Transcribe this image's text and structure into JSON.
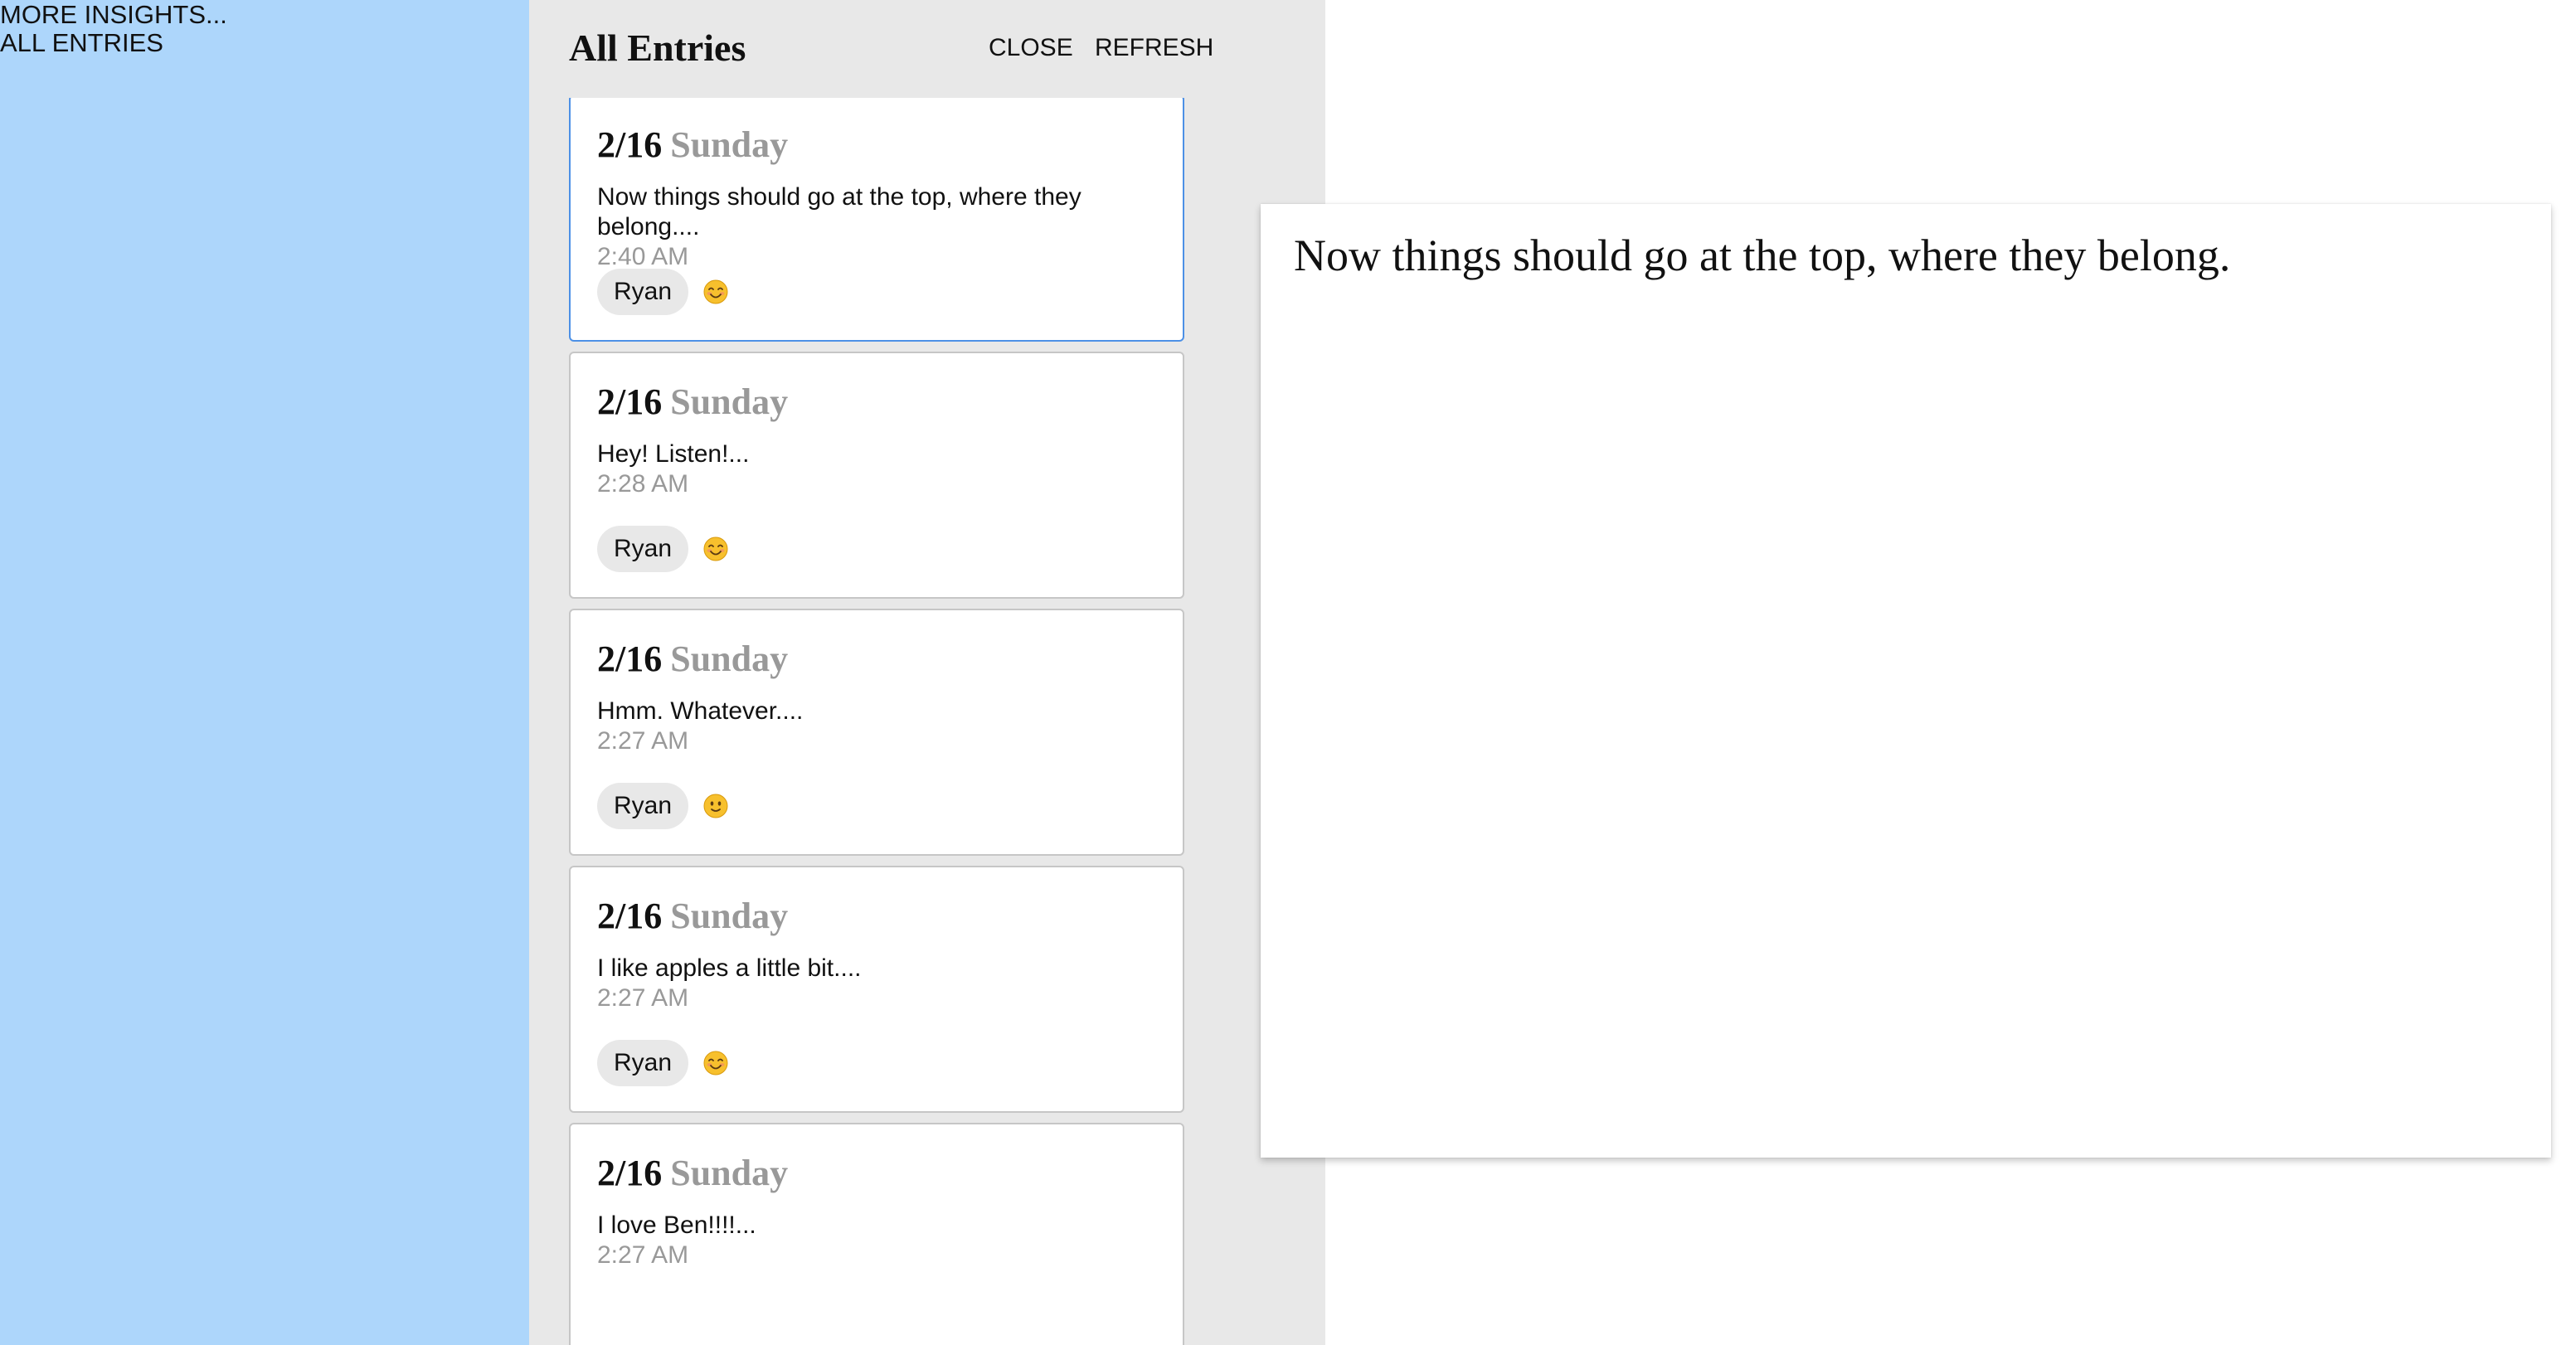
{
  "sidebar": {
    "links": [
      "MORE INSIGHTS...",
      "ALL ENTRIES"
    ]
  },
  "entries_panel": {
    "title": "All Entries",
    "close_label": "CLOSE",
    "refresh_label": "REFRESH",
    "entries": [
      {
        "date": "2/16",
        "day": "Sunday",
        "preview": "",
        "time": "",
        "author": "Ryan",
        "mood_icon": "smiling-face-icon",
        "selected": false
      },
      {
        "date": "2/16",
        "day": "Sunday",
        "preview": "Now things should go at the top, where they belong....",
        "time": "2:40 AM",
        "author": "Ryan",
        "mood_icon": "smiling-face-icon",
        "selected": true
      },
      {
        "date": "2/16",
        "day": "Sunday",
        "preview": "Hey! Listen!...",
        "time": "2:28 AM",
        "author": "Ryan",
        "mood_icon": "smiling-face-icon",
        "selected": false
      },
      {
        "date": "2/16",
        "day": "Sunday",
        "preview": "Hmm. Whatever....",
        "time": "2:27 AM",
        "author": "Ryan",
        "mood_icon": "slightly-smiling-face-icon",
        "selected": false
      },
      {
        "date": "2/16",
        "day": "Sunday",
        "preview": "I like apples a little bit....",
        "time": "2:27 AM",
        "author": "Ryan",
        "mood_icon": "smiling-face-icon",
        "selected": false
      },
      {
        "date": "2/16",
        "day": "Sunday",
        "preview": "I love Ben!!!!...",
        "time": "2:27 AM",
        "author": "",
        "mood_icon": "",
        "selected": false
      }
    ]
  },
  "detail": {
    "text": "Now things should go at the top, where they belong."
  },
  "colors": {
    "sidebar_bg": "#add6fb",
    "panel_bg": "#e8e8e8",
    "selected_border": "#4c90e6",
    "muted_text": "#999999"
  }
}
